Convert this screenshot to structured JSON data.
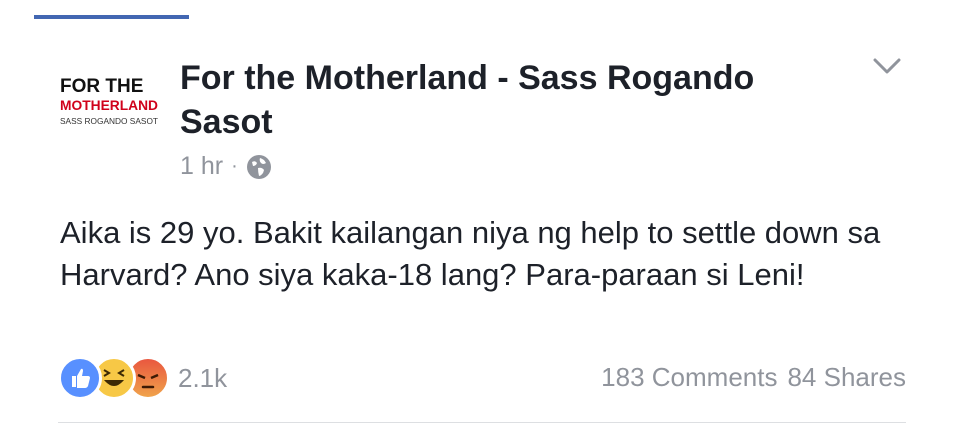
{
  "post": {
    "page_name": "For the Motherland - Sass Rogando Sasot",
    "avatar_text": {
      "line1": "FOR THE",
      "line2": "MOTHERLAND",
      "line3": "SASS ROGANDO SASOT"
    },
    "time": "1 hr",
    "separator": "·",
    "privacy_icon": "globe-icon",
    "text": "Aika is 29 yo. Bakit kailangan niya ng help to settle down sa Harvard? Ano siya kaka-18 lang? Para-paraan si Leni!",
    "reactions": {
      "icons": [
        "like-reaction-icon",
        "haha-reaction-icon",
        "angry-reaction-icon"
      ],
      "count": "2.1k"
    },
    "comments": "183 Comments",
    "shares": "84 Shares"
  },
  "colors": {
    "accent": "#4267b2",
    "muted": "#90949c",
    "text": "#1d2129",
    "brand_red": "#d0021b"
  }
}
